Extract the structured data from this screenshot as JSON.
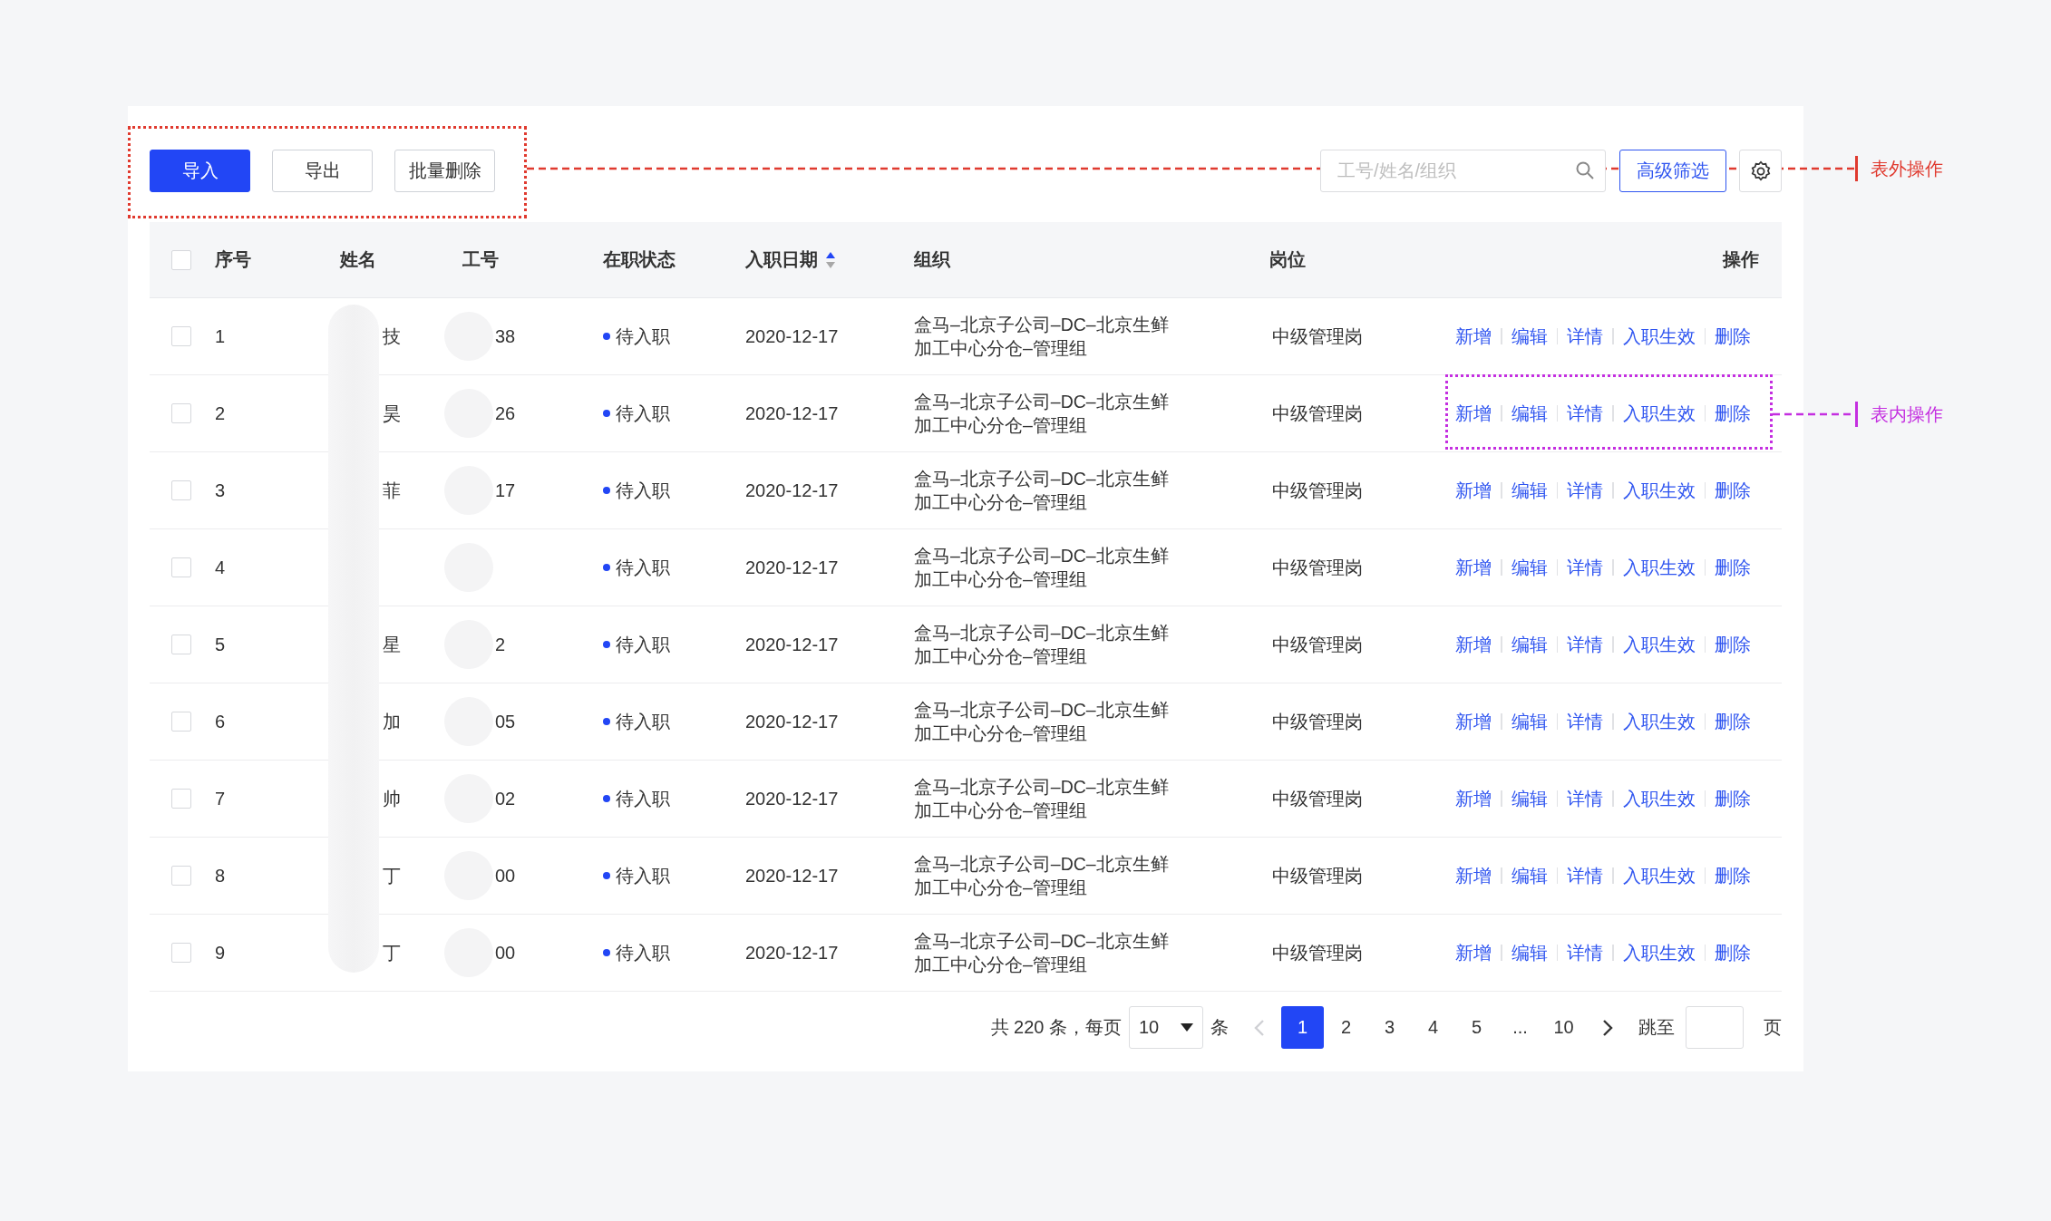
{
  "toolbar": {
    "buttons": [
      {
        "label": "导入",
        "kind": "primary"
      },
      {
        "label": "导出",
        "kind": "default"
      },
      {
        "label": "批量删除",
        "kind": "default"
      }
    ],
    "search": {
      "placeholder": "工号/姓名/组织"
    },
    "filter_button": "高级筛选"
  },
  "table": {
    "header_checked": false,
    "columns": [
      {
        "label": "序号"
      },
      {
        "label": "姓名"
      },
      {
        "label": "工号"
      },
      {
        "label": "在职状态"
      },
      {
        "label": "入职日期",
        "sort_ascending": true
      },
      {
        "label": "组织"
      },
      {
        "label": "岗位"
      },
      {
        "label": "操作"
      }
    ],
    "rows": [
      {
        "checked": false,
        "index": "1",
        "name": "技",
        "employee_id": "38",
        "status": "待入职",
        "date": "2020-12-17",
        "org": "盒马–北京子公司–DC–北京生鲜加工中心分仓–管理组",
        "position": "中级管理岗",
        "actions": [
          "新增",
          "编辑",
          "详情",
          "入职生效",
          "删除"
        ]
      },
      {
        "checked": false,
        "index": "2",
        "name": "昊",
        "employee_id": "26",
        "status": "待入职",
        "date": "2020-12-17",
        "org": "盒马–北京子公司–DC–北京生鲜加工中心分仓–管理组",
        "position": "中级管理岗",
        "actions": [
          "新增",
          "编辑",
          "详情",
          "入职生效",
          "删除"
        ]
      },
      {
        "checked": false,
        "index": "3",
        "name": "菲",
        "employee_id": "17",
        "status": "待入职",
        "date": "2020-12-17",
        "org": "盒马–北京子公司–DC–北京生鲜加工中心分仓–管理组",
        "position": "中级管理岗",
        "actions": [
          "新增",
          "编辑",
          "详情",
          "入职生效",
          "删除"
        ]
      },
      {
        "checked": false,
        "index": "4",
        "status": "待入职",
        "date": "2020-12-17",
        "org": "盒马–北京子公司–DC–北京生鲜加工中心分仓–管理组",
        "position": "中级管理岗",
        "actions": [
          "新增",
          "编辑",
          "详情",
          "入职生效",
          "删除"
        ]
      },
      {
        "checked": false,
        "index": "5",
        "name": "星",
        "employee_id": "2",
        "status": "待入职",
        "date": "2020-12-17",
        "org": "盒马–北京子公司–DC–北京生鲜加工中心分仓–管理组",
        "position": "中级管理岗",
        "actions": [
          "新增",
          "编辑",
          "详情",
          "入职生效",
          "删除"
        ]
      },
      {
        "checked": false,
        "index": "6",
        "name": "加",
        "employee_id": "05",
        "status": "待入职",
        "date": "2020-12-17",
        "org": "盒马–北京子公司–DC–北京生鲜加工中心分仓–管理组",
        "position": "中级管理岗",
        "actions": [
          "新增",
          "编辑",
          "详情",
          "入职生效",
          "删除"
        ]
      },
      {
        "checked": false,
        "index": "7",
        "name": "帅",
        "employee_id": "02",
        "status": "待入职",
        "date": "2020-12-17",
        "org": "盒马–北京子公司–DC–北京生鲜加工中心分仓–管理组",
        "position": "中级管理岗",
        "actions": [
          "新增",
          "编辑",
          "详情",
          "入职生效",
          "删除"
        ]
      },
      {
        "checked": false,
        "index": "8",
        "name": "丁",
        "employee_id": "00",
        "status": "待入职",
        "date": "2020-12-17",
        "org": "盒马–北京子公司–DC–北京生鲜加工中心分仓–管理组",
        "position": "中级管理岗",
        "actions": [
          "新增",
          "编辑",
          "详情",
          "入职生效",
          "删除"
        ]
      },
      {
        "checked": false,
        "index": "9",
        "name": "丁",
        "employee_id": "00",
        "status": "待入职",
        "date": "2020-12-17",
        "org": "盒马–北京子公司–DC–北京生鲜加工中心分仓–管理组",
        "position": "中级管理岗",
        "actions": [
          "新增",
          "编辑",
          "详情",
          "入职生效",
          "删除"
        ]
      }
    ]
  },
  "pagination": {
    "total": "共 220 条，每页",
    "page_size": "10",
    "unit": "条",
    "prev": {
      "disabled": true
    },
    "pages": [
      {
        "label": "1",
        "selected": true
      },
      {
        "label": "2",
        "selected": false
      },
      {
        "label": "3",
        "selected": false
      },
      {
        "label": "4",
        "selected": false
      },
      {
        "label": "5",
        "selected": false
      },
      {
        "label": "...",
        "selected": false
      },
      {
        "label": "10",
        "selected": false
      }
    ],
    "next": {
      "disabled": false
    },
    "jump_label": "跳至",
    "page_unit": "页"
  },
  "annotations": [
    {
      "label": "表外操作",
      "kind": "outer"
    },
    {
      "label": "表内操作",
      "kind": "inner"
    }
  ]
}
